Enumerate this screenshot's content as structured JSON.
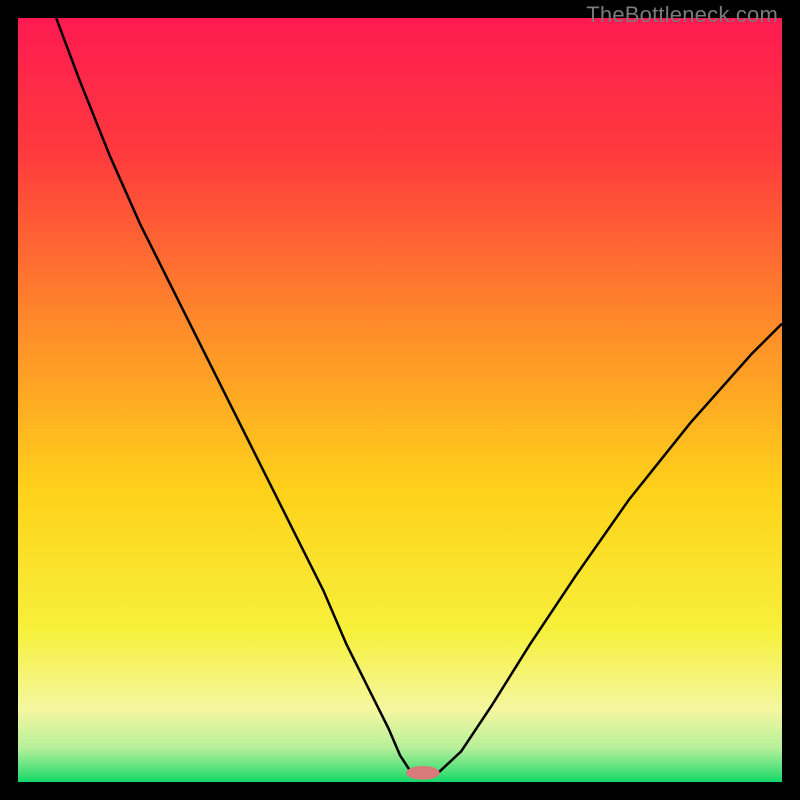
{
  "watermark": "TheBottleneck.com",
  "chart_data": {
    "type": "line",
    "title": "",
    "xlabel": "",
    "ylabel": "",
    "xlim": [
      0,
      100
    ],
    "ylim": [
      0,
      100
    ],
    "gradient_stops": [
      {
        "offset": 0,
        "color": "#ff1a52"
      },
      {
        "offset": 0.18,
        "color": "#ff3b3d"
      },
      {
        "offset": 0.4,
        "color": "#ff8a2a"
      },
      {
        "offset": 0.62,
        "color": "#ffd21a"
      },
      {
        "offset": 0.8,
        "color": "#f7f03a"
      },
      {
        "offset": 0.905,
        "color": "#f4f7a0"
      },
      {
        "offset": 0.955,
        "color": "#b8f09a"
      },
      {
        "offset": 0.985,
        "color": "#4fe07a"
      },
      {
        "offset": 1.0,
        "color": "#12d86a"
      }
    ],
    "curve": {
      "x": [
        5,
        8,
        12,
        16,
        20,
        24,
        28,
        32,
        36,
        40,
        43,
        46,
        48.5,
        50,
        51.5,
        53,
        55,
        58,
        62,
        67,
        73,
        80,
        88,
        96,
        100
      ],
      "y": [
        100,
        92,
        82,
        73,
        65,
        57,
        49,
        41,
        33,
        25,
        18,
        12,
        7,
        3.5,
        1.2,
        1.2,
        1.2,
        4,
        10,
        18,
        27,
        37,
        47,
        56,
        60
      ]
    },
    "flat_bottom": {
      "x_start": 51.5,
      "x_end": 55,
      "y": 1.2
    },
    "marker": {
      "x": 53,
      "y": 1.2,
      "color": "#d97a7a",
      "rx": 2.2,
      "ry": 0.9
    }
  }
}
